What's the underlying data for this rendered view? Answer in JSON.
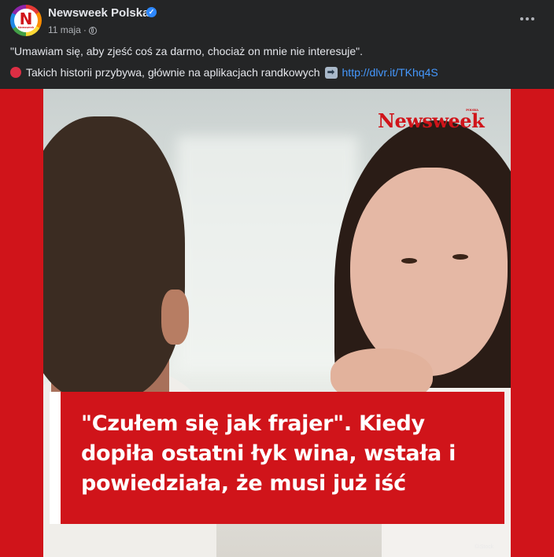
{
  "post": {
    "page_name": "Newsweek Polska",
    "date": "11 maja",
    "separator": "·",
    "privacy_icon": "globe-icon",
    "verified_icon": "verified-badge-icon",
    "avatar_letter": "N",
    "avatar_sub": "Newsweek",
    "text_line1": "\"Umawiam się, aby zjeść coś za darmo, chociaż on mnie nie interesuje\".",
    "text_line2": "Takich historii przybywa, głównie na aplikacjach randkowych",
    "arrow_glyph": "➡",
    "link": "http://dlvr.it/TKhq4S"
  },
  "image": {
    "logo": "Newsweek",
    "logo_small": "POLSKA",
    "caption": "\"Czułem się jak frajer\". Kiedy dopiła ostatni łyk wina, wstała i powiedziała, że musi już iść",
    "credit": "©iStock"
  },
  "colors": {
    "background": "#242526",
    "brand_red": "#d0141a",
    "link": "#4599ff",
    "verified": "#2d88ff"
  }
}
